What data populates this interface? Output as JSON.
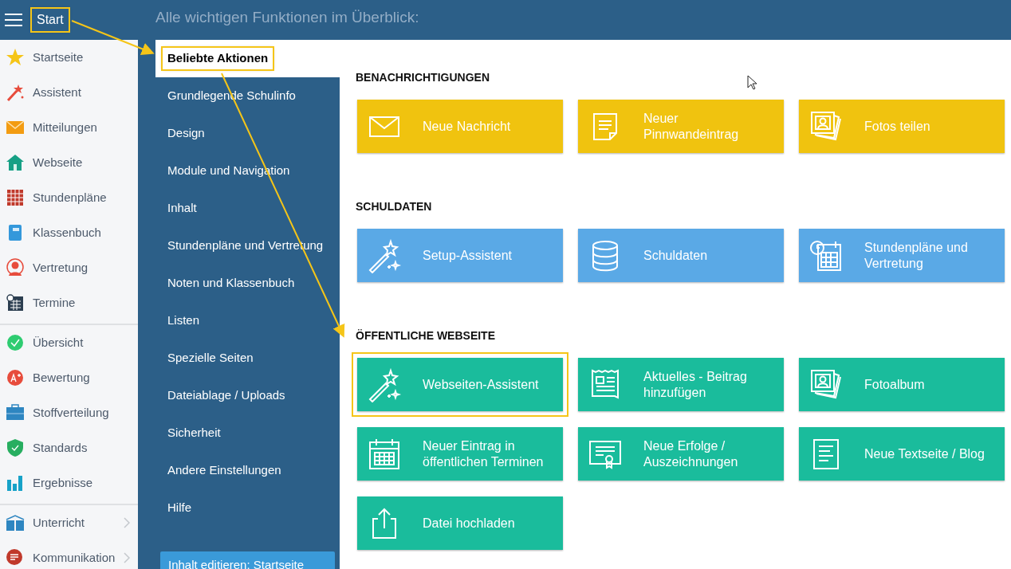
{
  "header": {
    "menu_label": "Start",
    "title": "Alle wichtigen Funktionen im Überblick:",
    "highlighted": true
  },
  "sidebar": {
    "groups": [
      {
        "items": [
          {
            "label": "Startseite",
            "has_submenu": false
          },
          {
            "label": "Assistent",
            "has_submenu": false
          },
          {
            "label": "Mitteilungen",
            "has_submenu": false
          },
          {
            "label": "Webseite",
            "has_submenu": false
          },
          {
            "label": "Stundenpläne",
            "has_submenu": false
          },
          {
            "label": "Klassenbuch",
            "has_submenu": false
          },
          {
            "label": "Vertretung",
            "has_submenu": false
          },
          {
            "label": "Termine",
            "has_submenu": false
          }
        ]
      },
      {
        "items": [
          {
            "label": "Übersicht",
            "has_submenu": false
          },
          {
            "label": "Bewertung",
            "has_submenu": false
          },
          {
            "label": "Stoffverteilung",
            "has_submenu": false
          },
          {
            "label": "Standards",
            "has_submenu": false
          },
          {
            "label": "Ergebnisse",
            "has_submenu": false
          }
        ]
      },
      {
        "items": [
          {
            "label": "Unterricht",
            "has_submenu": true
          },
          {
            "label": "Kommunikation",
            "has_submenu": true
          }
        ]
      }
    ]
  },
  "settings_nav": {
    "items": [
      {
        "label": "Beliebte Aktionen",
        "selected": true,
        "highlighted": true
      },
      {
        "label": "Grundlegende Schulinfo",
        "selected": false,
        "highlighted": false
      },
      {
        "label": "Design",
        "selected": false,
        "highlighted": false
      },
      {
        "label": "Module und Navigation",
        "selected": false,
        "highlighted": false
      },
      {
        "label": "Inhalt",
        "selected": false,
        "highlighted": false
      },
      {
        "label": "Stundenpläne und Vertretung",
        "selected": false,
        "highlighted": false
      },
      {
        "label": "Noten und Klassenbuch",
        "selected": false,
        "highlighted": false
      },
      {
        "label": "Listen",
        "selected": false,
        "highlighted": false
      },
      {
        "label": "Spezielle Seiten",
        "selected": false,
        "highlighted": false
      },
      {
        "label": "Dateiablage / Uploads",
        "selected": false,
        "highlighted": false
      },
      {
        "label": "Sicherheit",
        "selected": false,
        "highlighted": false
      },
      {
        "label": "Andere Einstellungen",
        "selected": false,
        "highlighted": false
      },
      {
        "label": "Hilfe",
        "selected": false,
        "highlighted": false
      }
    ],
    "edit_button": "Inhalt editieren: Startseite"
  },
  "sections": [
    {
      "title": "BENACHRICHTIGUNGEN",
      "color": "#f0c30f",
      "tiles": [
        {
          "label": "Neue Nachricht",
          "highlighted": false
        },
        {
          "label": "Neuer Pinnwandeintrag",
          "highlighted": false
        },
        {
          "label": "Fotos teilen",
          "highlighted": false
        }
      ]
    },
    {
      "title": "SCHULDATEN",
      "color": "#5aa9e6",
      "tiles": [
        {
          "label": "Setup-Assistent",
          "highlighted": false
        },
        {
          "label": "Schuldaten",
          "highlighted": false
        },
        {
          "label": "Stundenpläne und Vertretung",
          "highlighted": false
        }
      ]
    },
    {
      "title": "ÖFFENTLICHE WEBSEITE",
      "color": "#1abc9c",
      "tiles": [
        {
          "label": "Webseiten-Assistent",
          "highlighted": true
        },
        {
          "label": "Aktuelles - Beitrag hinzufügen",
          "highlighted": false
        },
        {
          "label": "Fotoalbum",
          "highlighted": false
        },
        {
          "label": "Neuer Eintrag in öffentlichen Terminen",
          "highlighted": false
        },
        {
          "label": "Neue Erfolge / Auszeichnungen",
          "highlighted": false
        },
        {
          "label": "Neue Textseite / Blog",
          "highlighted": false
        },
        {
          "label": "Datei hochladen",
          "highlighted": false
        }
      ]
    }
  ]
}
